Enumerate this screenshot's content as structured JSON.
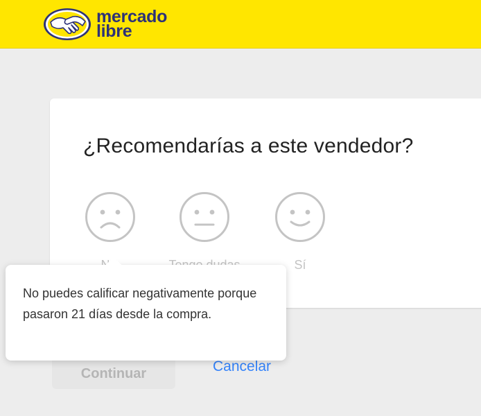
{
  "header": {
    "brand_line1": "mercado",
    "brand_line2": "libre",
    "brand_color": "#2d3277",
    "bar_color": "#ffe600"
  },
  "question": "¿Recomendarías a este vendedor?",
  "options": [
    {
      "label": "No",
      "icon": "sad-face-icon"
    },
    {
      "label": "Tengo dudas",
      "icon": "neutral-face-icon"
    },
    {
      "label": "Sí",
      "icon": "happy-face-icon"
    }
  ],
  "tooltip": {
    "text": "No puedes calificar negativamente porque pasaron 21 días desde la compra."
  },
  "actions": {
    "continue_label": "Continuar",
    "cancel_label": "Cancelar",
    "link_color": "#3483fa"
  }
}
